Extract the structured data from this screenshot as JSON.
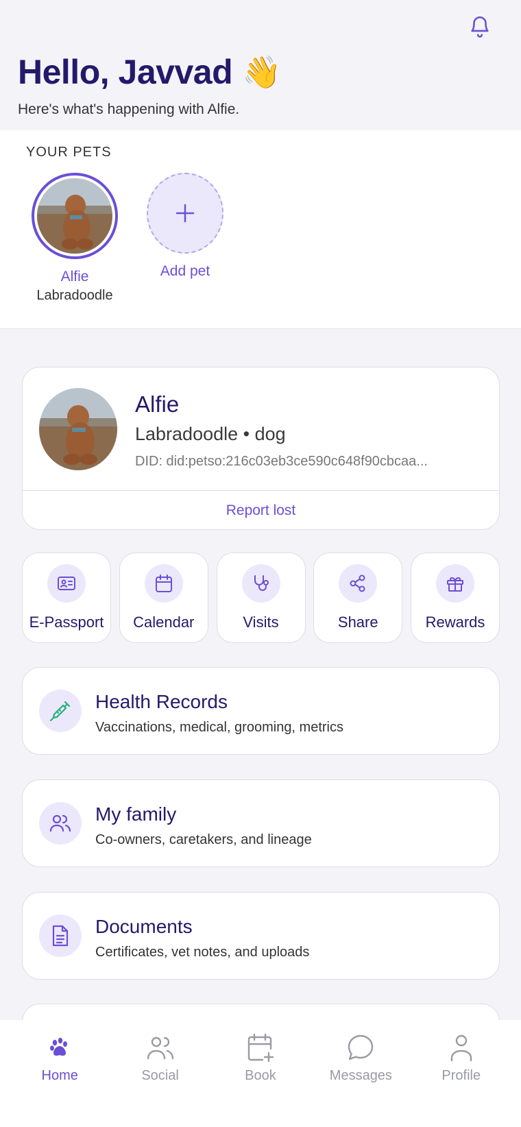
{
  "header": {
    "greeting": "Hello, Javvad",
    "wave_emoji": "👋",
    "subtitle": "Here's what's happening with Alfie."
  },
  "pets_section": {
    "label": "YOUR PETS",
    "pets": [
      {
        "name": "Alfie",
        "breed": "Labradoodle"
      }
    ],
    "add_label": "Add pet"
  },
  "profile": {
    "name": "Alfie",
    "breed_type": "Labradoodle • dog",
    "did": "DID: did:petso:216c03eb3ce590c648f90cbcaa...",
    "report_label": "Report lost"
  },
  "actions": [
    {
      "label": "E-Passport",
      "icon": "id-card-icon"
    },
    {
      "label": "Calendar",
      "icon": "calendar-icon"
    },
    {
      "label": "Visits",
      "icon": "stethoscope-icon"
    },
    {
      "label": "Share",
      "icon": "share-icon"
    },
    {
      "label": "Rewards",
      "icon": "gift-icon"
    }
  ],
  "list_cards": [
    {
      "title": "Health Records",
      "subtitle": "Vaccinations, medical, grooming, metrics",
      "icon": "syringe-icon"
    },
    {
      "title": "My family",
      "subtitle": "Co-owners, caretakers, and lineage",
      "icon": "users-icon"
    },
    {
      "title": "Documents",
      "subtitle": "Certificates, vet notes, and uploads",
      "icon": "document-icon"
    }
  ],
  "nav": [
    {
      "label": "Home",
      "icon": "paw-icon",
      "active": true
    },
    {
      "label": "Social",
      "icon": "users-icon",
      "active": false
    },
    {
      "label": "Book",
      "icon": "calendar-plus-icon",
      "active": false
    },
    {
      "label": "Messages",
      "icon": "chat-bubble-icon",
      "active": false
    },
    {
      "label": "Profile",
      "icon": "user-icon",
      "active": false
    }
  ],
  "colors": {
    "accent": "#6a4fd6",
    "heading": "#24196b",
    "icon_bg": "#ece8fb",
    "green_icon": "#22b07d"
  }
}
